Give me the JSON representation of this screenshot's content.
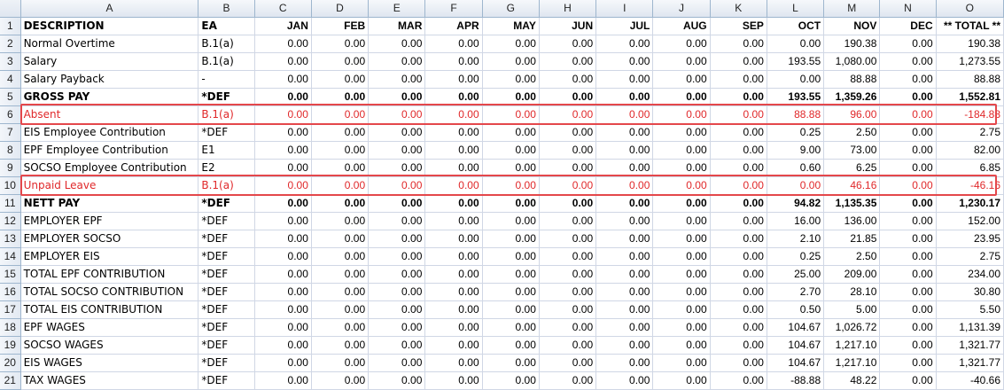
{
  "columns": [
    "A",
    "B",
    "C",
    "D",
    "E",
    "F",
    "G",
    "H",
    "I",
    "J",
    "K",
    "L",
    "M",
    "N",
    "O"
  ],
  "rows": [
    {
      "n": "1",
      "style": "bold",
      "cells": [
        "DESCRIPTION",
        "EA",
        "JAN",
        "FEB",
        "MAR",
        "APR",
        "MAY",
        "JUN",
        "JUL",
        "AUG",
        "SEP",
        "OCT",
        "NOV",
        "DEC",
        "** TOTAL **"
      ]
    },
    {
      "n": "2",
      "style": "",
      "cells": [
        "Normal Overtime",
        "B.1(a)",
        "0.00",
        "0.00",
        "0.00",
        "0.00",
        "0.00",
        "0.00",
        "0.00",
        "0.00",
        "0.00",
        "0.00",
        "190.38",
        "0.00",
        "190.38"
      ]
    },
    {
      "n": "3",
      "style": "",
      "cells": [
        "Salary",
        "B.1(a)",
        "0.00",
        "0.00",
        "0.00",
        "0.00",
        "0.00",
        "0.00",
        "0.00",
        "0.00",
        "0.00",
        "193.55",
        "1,080.00",
        "0.00",
        "1,273.55"
      ]
    },
    {
      "n": "4",
      "style": "",
      "cells": [
        "Salary Payback",
        "-",
        "0.00",
        "0.00",
        "0.00",
        "0.00",
        "0.00",
        "0.00",
        "0.00",
        "0.00",
        "0.00",
        "0.00",
        "88.88",
        "0.00",
        "88.88"
      ]
    },
    {
      "n": "5",
      "style": "bold",
      "cells": [
        "GROSS PAY",
        "*DEF",
        "0.00",
        "0.00",
        "0.00",
        "0.00",
        "0.00",
        "0.00",
        "0.00",
        "0.00",
        "0.00",
        "193.55",
        "1,359.26",
        "0.00",
        "1,552.81"
      ]
    },
    {
      "n": "6",
      "style": "red",
      "cells": [
        "Absent",
        "B.1(a)",
        "0.00",
        "0.00",
        "0.00",
        "0.00",
        "0.00",
        "0.00",
        "0.00",
        "0.00",
        "0.00",
        "88.88",
        "96.00",
        "0.00",
        "-184.88"
      ]
    },
    {
      "n": "7",
      "style": "",
      "cells": [
        "EIS Employee Contribution",
        "*DEF",
        "0.00",
        "0.00",
        "0.00",
        "0.00",
        "0.00",
        "0.00",
        "0.00",
        "0.00",
        "0.00",
        "0.25",
        "2.50",
        "0.00",
        "2.75"
      ]
    },
    {
      "n": "8",
      "style": "",
      "cells": [
        "EPF Employee Contribution",
        "E1",
        "0.00",
        "0.00",
        "0.00",
        "0.00",
        "0.00",
        "0.00",
        "0.00",
        "0.00",
        "0.00",
        "9.00",
        "73.00",
        "0.00",
        "82.00"
      ]
    },
    {
      "n": "9",
      "style": "",
      "cells": [
        "SOCSO Employee Contribution",
        "E2",
        "0.00",
        "0.00",
        "0.00",
        "0.00",
        "0.00",
        "0.00",
        "0.00",
        "0.00",
        "0.00",
        "0.60",
        "6.25",
        "0.00",
        "6.85"
      ]
    },
    {
      "n": "10",
      "style": "red",
      "cells": [
        "Unpaid Leave",
        "B.1(a)",
        "0.00",
        "0.00",
        "0.00",
        "0.00",
        "0.00",
        "0.00",
        "0.00",
        "0.00",
        "0.00",
        "0.00",
        "46.16",
        "0.00",
        "-46.16"
      ]
    },
    {
      "n": "11",
      "style": "bold",
      "cells": [
        "NETT PAY",
        "*DEF",
        "0.00",
        "0.00",
        "0.00",
        "0.00",
        "0.00",
        "0.00",
        "0.00",
        "0.00",
        "0.00",
        "94.82",
        "1,135.35",
        "0.00",
        "1,230.17"
      ]
    },
    {
      "n": "12",
      "style": "",
      "cells": [
        "EMPLOYER EPF",
        "*DEF",
        "0.00",
        "0.00",
        "0.00",
        "0.00",
        "0.00",
        "0.00",
        "0.00",
        "0.00",
        "0.00",
        "16.00",
        "136.00",
        "0.00",
        "152.00"
      ]
    },
    {
      "n": "13",
      "style": "",
      "cells": [
        "EMPLOYER SOCSO",
        "*DEF",
        "0.00",
        "0.00",
        "0.00",
        "0.00",
        "0.00",
        "0.00",
        "0.00",
        "0.00",
        "0.00",
        "2.10",
        "21.85",
        "0.00",
        "23.95"
      ]
    },
    {
      "n": "14",
      "style": "",
      "cells": [
        "EMPLOYER EIS",
        "*DEF",
        "0.00",
        "0.00",
        "0.00",
        "0.00",
        "0.00",
        "0.00",
        "0.00",
        "0.00",
        "0.00",
        "0.25",
        "2.50",
        "0.00",
        "2.75"
      ]
    },
    {
      "n": "15",
      "style": "",
      "cells": [
        "TOTAL EPF CONTRIBUTION",
        "*DEF",
        "0.00",
        "0.00",
        "0.00",
        "0.00",
        "0.00",
        "0.00",
        "0.00",
        "0.00",
        "0.00",
        "25.00",
        "209.00",
        "0.00",
        "234.00"
      ]
    },
    {
      "n": "16",
      "style": "",
      "cells": [
        "TOTAL SOCSO CONTRIBUTION",
        "*DEF",
        "0.00",
        "0.00",
        "0.00",
        "0.00",
        "0.00",
        "0.00",
        "0.00",
        "0.00",
        "0.00",
        "2.70",
        "28.10",
        "0.00",
        "30.80"
      ]
    },
    {
      "n": "17",
      "style": "",
      "cells": [
        "TOTAL EIS CONTRIBUTION",
        "*DEF",
        "0.00",
        "0.00",
        "0.00",
        "0.00",
        "0.00",
        "0.00",
        "0.00",
        "0.00",
        "0.00",
        "0.50",
        "5.00",
        "0.00",
        "5.50"
      ]
    },
    {
      "n": "18",
      "style": "",
      "cells": [
        "EPF WAGES",
        "*DEF",
        "0.00",
        "0.00",
        "0.00",
        "0.00",
        "0.00",
        "0.00",
        "0.00",
        "0.00",
        "0.00",
        "104.67",
        "1,026.72",
        "0.00",
        "1,131.39"
      ]
    },
    {
      "n": "19",
      "style": "",
      "cells": [
        "SOCSO WAGES",
        "*DEF",
        "0.00",
        "0.00",
        "0.00",
        "0.00",
        "0.00",
        "0.00",
        "0.00",
        "0.00",
        "0.00",
        "104.67",
        "1,217.10",
        "0.00",
        "1,321.77"
      ]
    },
    {
      "n": "20",
      "style": "",
      "cells": [
        "EIS WAGES",
        "*DEF",
        "0.00",
        "0.00",
        "0.00",
        "0.00",
        "0.00",
        "0.00",
        "0.00",
        "0.00",
        "0.00",
        "104.67",
        "1,217.10",
        "0.00",
        "1,321.77"
      ]
    },
    {
      "n": "21",
      "style": "",
      "cells": [
        "TAX WAGES",
        "*DEF",
        "0.00",
        "0.00",
        "0.00",
        "0.00",
        "0.00",
        "0.00",
        "0.00",
        "0.00",
        "0.00",
        "-88.88",
        "48.22",
        "0.00",
        "-40.66"
      ]
    }
  ],
  "highlighted_rows": [
    "6",
    "10"
  ],
  "colors": {
    "highlight_border": "#e4474b",
    "red_text": "#e0282a",
    "header_border": "#9eb6ce",
    "grid": "#d0d7e5"
  }
}
